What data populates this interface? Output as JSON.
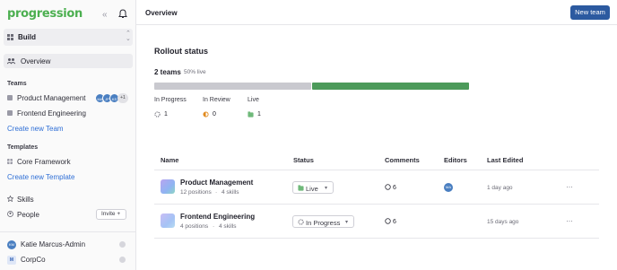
{
  "app": {
    "logo": "progression"
  },
  "sidebar": {
    "workspace": "Build",
    "overview": "Overview",
    "teams_header": "Teams",
    "teams": [
      {
        "label": "Product Management"
      },
      {
        "label": "Frontend Engineering"
      }
    ],
    "team_avatars": [
      "MA",
      "JP",
      "KS"
    ],
    "team_avatars_more": "+1",
    "create_team": "Create new Team",
    "templates_header": "Templates",
    "templates": [
      {
        "label": "Core Framework"
      }
    ],
    "create_template": "Create new Template",
    "skills": "Skills",
    "people": "People",
    "invite": "Invite +",
    "user": {
      "initials": "KM",
      "name": "Katie Marcus-Admin"
    },
    "org": {
      "initials": "M",
      "name": "CorpCo"
    }
  },
  "header": {
    "title": "Overview",
    "new_team": "New team"
  },
  "rollout": {
    "title": "Rollout status",
    "teams_count": "2 teams",
    "pct_live": "50% live",
    "progress": {
      "not_live_fraction": 0.5,
      "live_fraction": 0.5
    },
    "colors": {
      "in_progress": "#c9c9cf",
      "live": "#4c9a5a"
    },
    "stats": [
      {
        "label": "In Progress",
        "value": "1"
      },
      {
        "label": "In Review",
        "value": "0"
      },
      {
        "label": "Live",
        "value": "1"
      }
    ]
  },
  "table": {
    "headers": {
      "name": "Name",
      "status": "Status",
      "comments": "Comments",
      "editors": "Editors",
      "last_edited": "Last Edited"
    },
    "rows": [
      {
        "name": "Product Management",
        "positions": "12 positions",
        "skills": "4 skills",
        "status": "Live",
        "comments": "6",
        "editor": "MA",
        "last_edited": "1 day ago",
        "more": "···"
      },
      {
        "name": "Frontend Engineering",
        "positions": "4 positions",
        "skills": "4 skills",
        "status": "In Progress",
        "comments": "6",
        "editor": "",
        "last_edited": "15 days ago",
        "more": "···"
      }
    ]
  }
}
